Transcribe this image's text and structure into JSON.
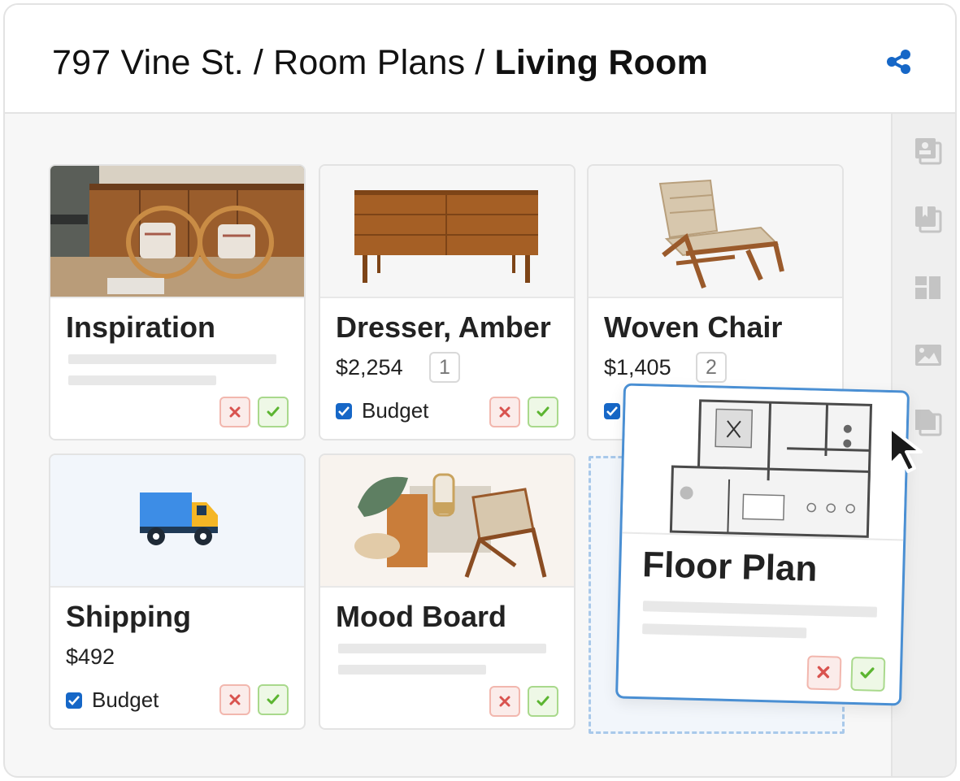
{
  "breadcrumb": {
    "parts": [
      "797 Vine St.",
      "Room Plans"
    ],
    "separator": "/",
    "current": "Living Room"
  },
  "header": {
    "share_icon": "share-icon"
  },
  "sidebar": {
    "tools": [
      "image-stack-icon",
      "bookmark-stack-icon",
      "layout-blocks-icon",
      "picture-icon",
      "document-stack-icon"
    ]
  },
  "cards": {
    "inspiration": {
      "title": "Inspiration"
    },
    "dresser": {
      "title": "Dresser, Amber",
      "price": "$2,254",
      "badge": "1",
      "budget": "Budget",
      "budget_checked": true
    },
    "chair": {
      "title": "Woven Chair",
      "price": "$1,405",
      "badge": "2",
      "budget_checked": true
    },
    "shipping": {
      "title": "Shipping",
      "price": "$492",
      "budget": "Budget",
      "budget_checked": true
    },
    "moodboard": {
      "title": "Mood Board"
    },
    "floorplan": {
      "title": "Floor Plan"
    }
  },
  "colors": {
    "accent": "#1667c7",
    "reject": "#d9534f",
    "approve": "#5cb531",
    "drop_border": "#a9c9ea",
    "drag_border": "#4a8fd3"
  }
}
